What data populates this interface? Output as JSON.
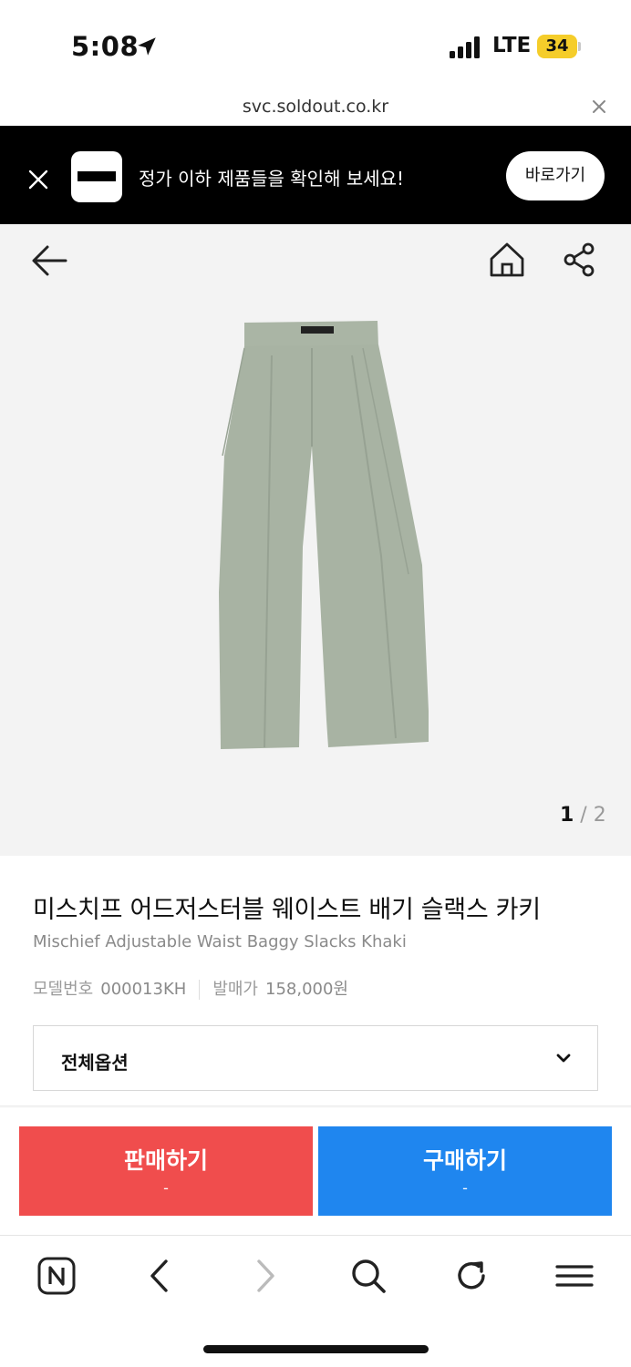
{
  "status_bar": {
    "time": "5:08",
    "network": "LTE",
    "battery": "34"
  },
  "browser": {
    "url": "svc.soldout.co.kr"
  },
  "banner": {
    "text": "정가 이하 제품들을 확인해 보세요!",
    "button_label": "바로가기"
  },
  "gallery": {
    "current_page": "1",
    "separator": " / ",
    "total_pages": "2"
  },
  "product": {
    "name_ko": "미스치프 어드저스터블 웨이스트 배기 슬랙스 카키",
    "name_en": "Mischief Adjustable Waist Baggy Slacks Khaki",
    "model_label": "모델번호",
    "model_number": "000013KH",
    "release_label": "발매가",
    "release_price": "158,000원",
    "image_color": "#a8b3a3"
  },
  "options": {
    "selected": "전체옵션"
  },
  "actions": {
    "sell_label": "판매하기",
    "sell_price": "-",
    "buy_label": "구매하기",
    "buy_price": "-"
  },
  "colors": {
    "sell": "#f04d4d",
    "buy": "#1f86ef",
    "banner_bg": "#000000",
    "battery": "#f5cd2a"
  }
}
